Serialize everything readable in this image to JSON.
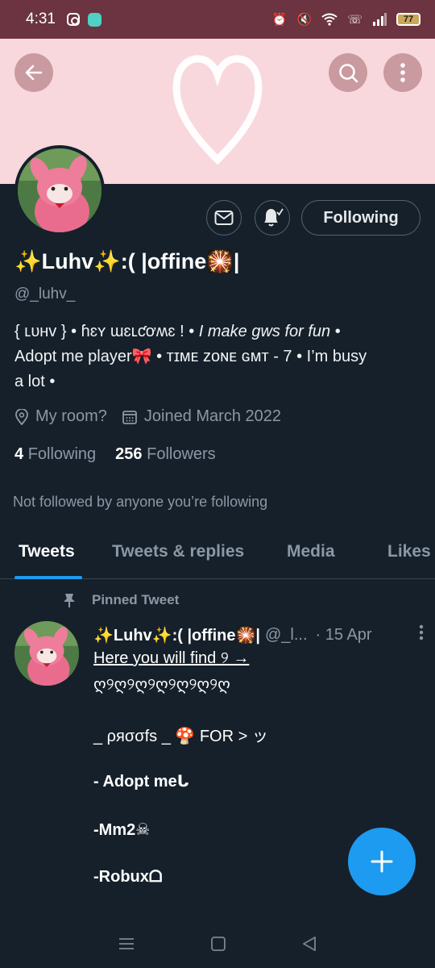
{
  "status_bar": {
    "time": "4:31",
    "battery": "77",
    "icons_left": [
      "instagram-icon",
      "app-icon"
    ],
    "icons_right": [
      "alarm-icon",
      "mute-icon",
      "wifi-icon",
      "call-icon",
      "signal-icon",
      "battery-icon"
    ]
  },
  "banner": {
    "color": "#f8d8dd",
    "image": "white-heart-outline"
  },
  "header_buttons": {
    "back": "back-arrow-icon",
    "search": "search-icon",
    "more": "more-vertical-icon"
  },
  "profile": {
    "display_name": "✨Luhv✨:( |offine🎇|",
    "handle": "@_luhv_",
    "bio_line1_a": "{ ʟᴜʜᴠ } • ɦɛʏ ɯɛʟƈơʍɛ ! • ",
    "bio_line1_b": "I make gws for fun",
    "bio_line1_c": " •",
    "bio_line2": "Adopt me player🎀 • ᴛɪᴍᴇ ᴢᴏɴᴇ ɢᴍᴛ - 7 • I’m busy",
    "bio_line3": "a lot •",
    "location": "My room?",
    "joined": "Joined March 2022",
    "following_count": "4",
    "following_label": "Following",
    "followers_count": "256",
    "followers_label": "Followers",
    "not_followed_text": "Not followed by anyone you’re following"
  },
  "actions": {
    "following_button": "Following"
  },
  "tabs": [
    {
      "label": "Tweets",
      "active": true
    },
    {
      "label": "Tweets & replies",
      "active": false
    },
    {
      "label": "Media",
      "active": false
    },
    {
      "label": "Likes",
      "active": false
    }
  ],
  "pinned_tweet": {
    "pinned_label": "Pinned Tweet",
    "name": "✨Luhv✨:( |offine🎇|",
    "handle": "@_l...",
    "date": "· 15 Apr",
    "line1": "Here you will find ୨ →",
    "line2": "ღ୨ღ୨ღ୨ღ୨ღ୨ღ୨ღ",
    "line3": "_ ρяσσfs _ 🍄  FOR > ッ",
    "line4": "- Adopt meᒐ",
    "line5": "-Mm2☠",
    "line6": "-Robuxᗝ"
  },
  "colors": {
    "background": "#15202b",
    "accent": "#1d9bf0",
    "status_bar": "#6b3440",
    "muted_text": "#8b98a5"
  }
}
